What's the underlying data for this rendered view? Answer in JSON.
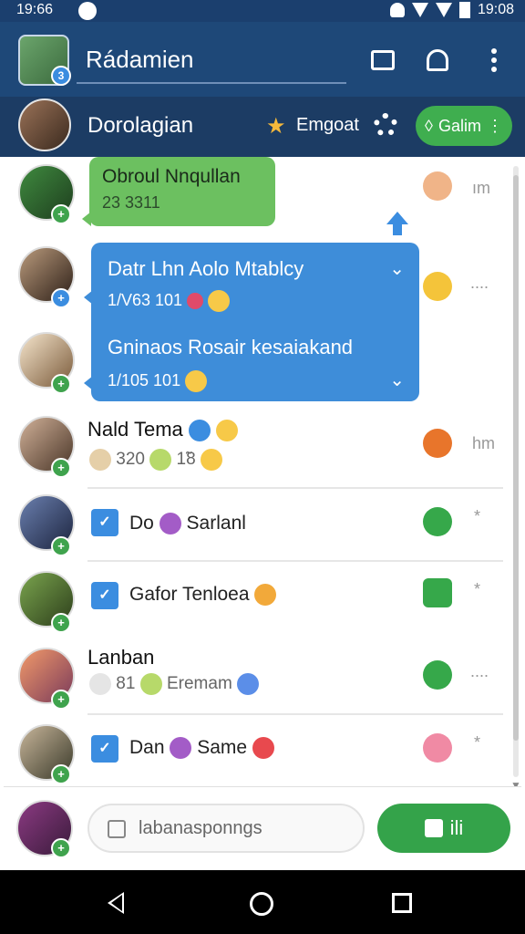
{
  "status": {
    "time_left": "19:66",
    "time_right": "19:08"
  },
  "header": {
    "title": "Rádamien",
    "avatar_badge": "3"
  },
  "subheader": {
    "title": "Dorolagian",
    "action": "Emgoat",
    "pill": "Galim"
  },
  "chats": {
    "green_bubble": {
      "title": "Obroul Nnqullan",
      "meta": "23 3311"
    },
    "blue_bubble": {
      "msg_a": "Datr Lhn Aolo Mtablcy",
      "time_a": "1/V63 101",
      "msg_b": "Gninaos Rosair kesaiakand",
      "time_b": "1/105 101"
    },
    "row1_meta": "ım",
    "row2_meta": "....",
    "row3": {
      "title": "Nald Tema",
      "sub_a": "320",
      "sub_b": "1̃8",
      "meta": "hm"
    },
    "row4": {
      "text_a": "Do",
      "text_b": "Sarlanl",
      "meta": "*"
    },
    "row5": {
      "text": "Gafor Tenloea",
      "meta": "*"
    },
    "row6": {
      "title": "Lanban",
      "sub_a": "81",
      "sub_b": "Eremam",
      "meta": "...."
    },
    "row7": {
      "text_a": "Dan",
      "text_b": "Same",
      "meta": "*"
    }
  },
  "composer": {
    "placeholder": "labanasponngs",
    "send_label": "ili"
  },
  "colors": {
    "header_blue": "#1e4878",
    "accent_green": "#3fae4f",
    "bubble_blue": "#3e8dd9"
  }
}
